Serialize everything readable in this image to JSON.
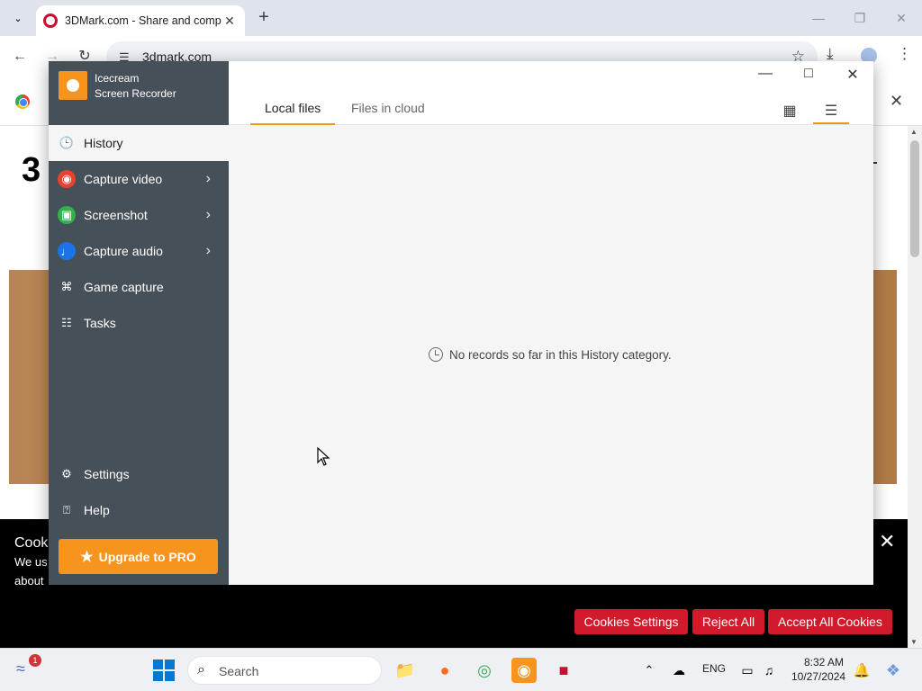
{
  "browser": {
    "tab_title": "3DMark.com - Share and comp",
    "url": "3dmark.com"
  },
  "webpage": {
    "logo_text": "3",
    "cookie": {
      "title": "Cook",
      "text_line1": "We us",
      "text_line2": "about",
      "settings_label": "Cookies Settings",
      "reject_label": "Reject All",
      "accept_label": "Accept All Cookies"
    }
  },
  "app": {
    "brand_line1": "Icecream",
    "brand_line2": "Screen Recorder",
    "nav": [
      {
        "label": "History"
      },
      {
        "label": "Capture video"
      },
      {
        "label": "Screenshot"
      },
      {
        "label": "Capture audio"
      },
      {
        "label": "Game capture"
      },
      {
        "label": "Tasks"
      }
    ],
    "settings_label": "Settings",
    "help_label": "Help",
    "upgrade_label": "Upgrade to PRO",
    "tabs": [
      "Local files",
      "Files in cloud"
    ],
    "empty_message": "No records so far in this History category."
  },
  "taskbar": {
    "search_placeholder": "Search",
    "notification_count": "1",
    "language": "ENG",
    "time": "8:32 AM",
    "date": "10/27/2024"
  },
  "colors": {
    "accent": "#f7941d",
    "sidebar": "#465058",
    "cookie_button": "#d11a2a",
    "capture_video": "#e8432e",
    "screenshot": "#2fb34a",
    "capture_audio": "#1a73e8"
  }
}
